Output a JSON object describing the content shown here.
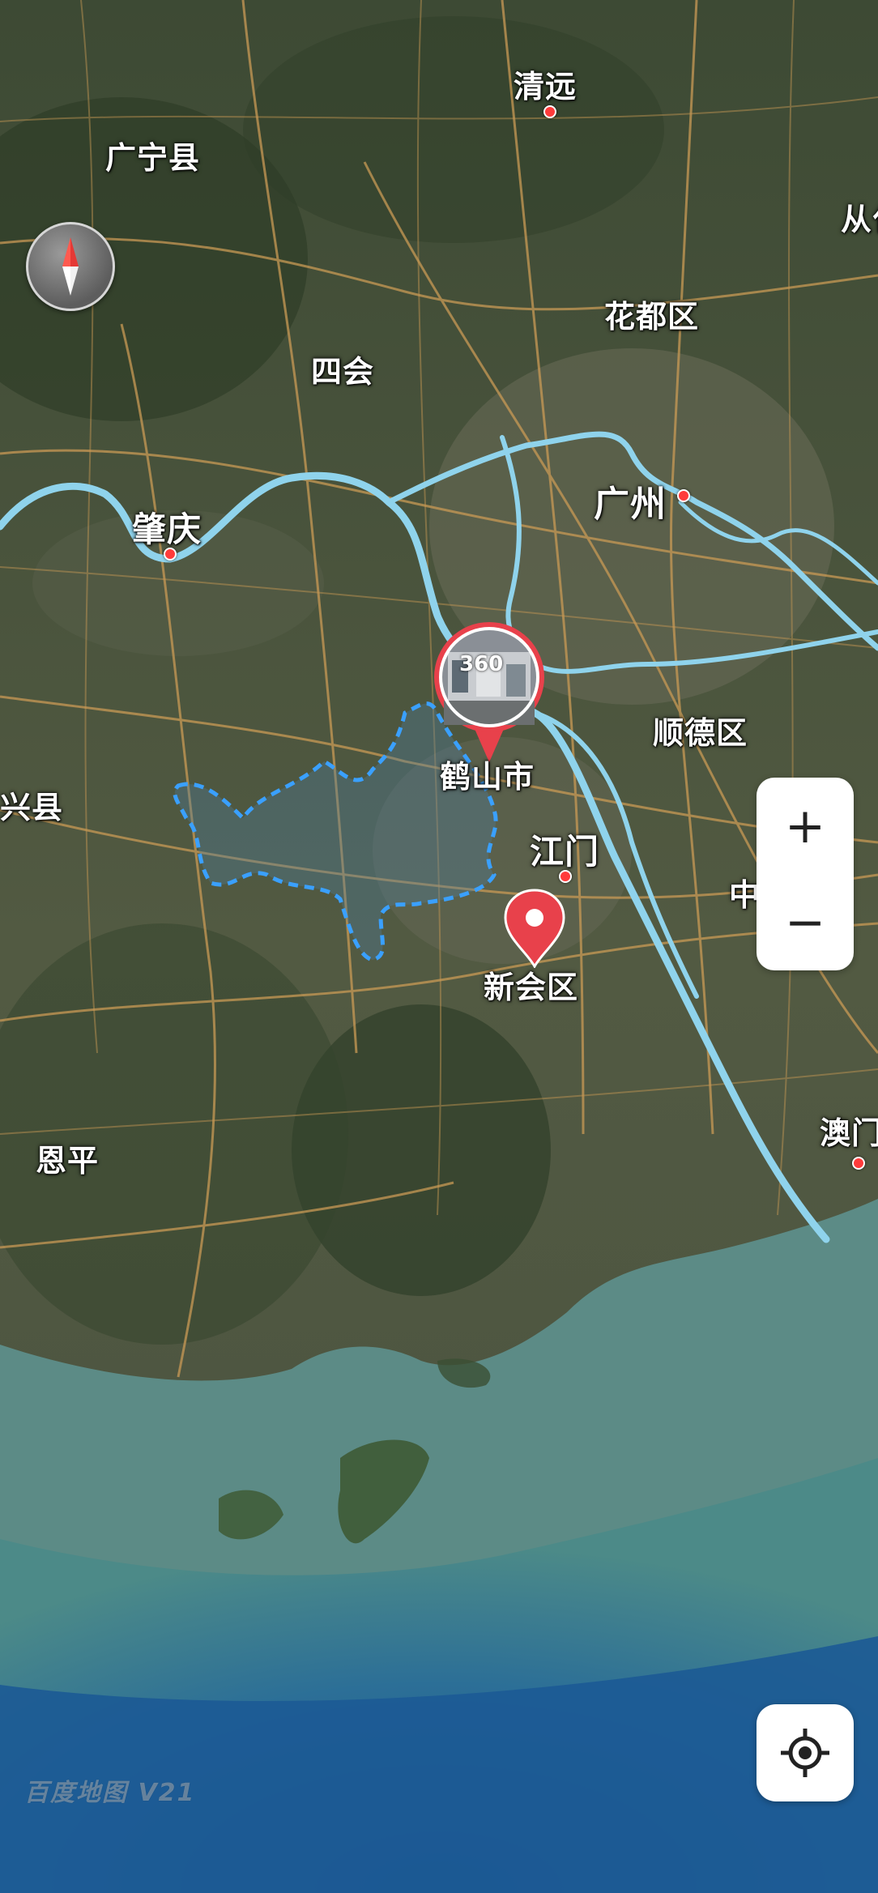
{
  "map": {
    "type": "satellite",
    "colors": {
      "land": "#3f4a34",
      "land_light": "#6b6f57",
      "river": "#8fd3ec",
      "road": "#c99a55",
      "sea_shallow": "#5a8a86",
      "sea_deep": "#1e5a8f",
      "boundary": "#3aa0ff",
      "marker_red": "#e8414b"
    }
  },
  "labels": {
    "qingyuan": "清远",
    "guangning": "广宁县",
    "cong": "从化",
    "huadu": "花都区",
    "sihui": "四会",
    "guangzhou": "广州",
    "zhaoqing": "肇庆",
    "shunde": "顺德区",
    "xing": "兴县",
    "heshan": "鹤山市",
    "jiangmen": "江门",
    "zhong": "中",
    "xinhui": "新会区",
    "enping": "恩平",
    "aomen": "澳门"
  },
  "markers": {
    "panorama": {
      "badge": "360",
      "label": "鹤山市",
      "icon": "panorama-thumbnail-icon"
    },
    "selected_pin": {
      "label": "新会区",
      "icon": "location-pin-icon"
    }
  },
  "controls": {
    "compass": "compass-icon",
    "zoom_in": "+",
    "zoom_out": "−",
    "locate": "locate-me-icon"
  },
  "watermark": "百度地图 V21"
}
